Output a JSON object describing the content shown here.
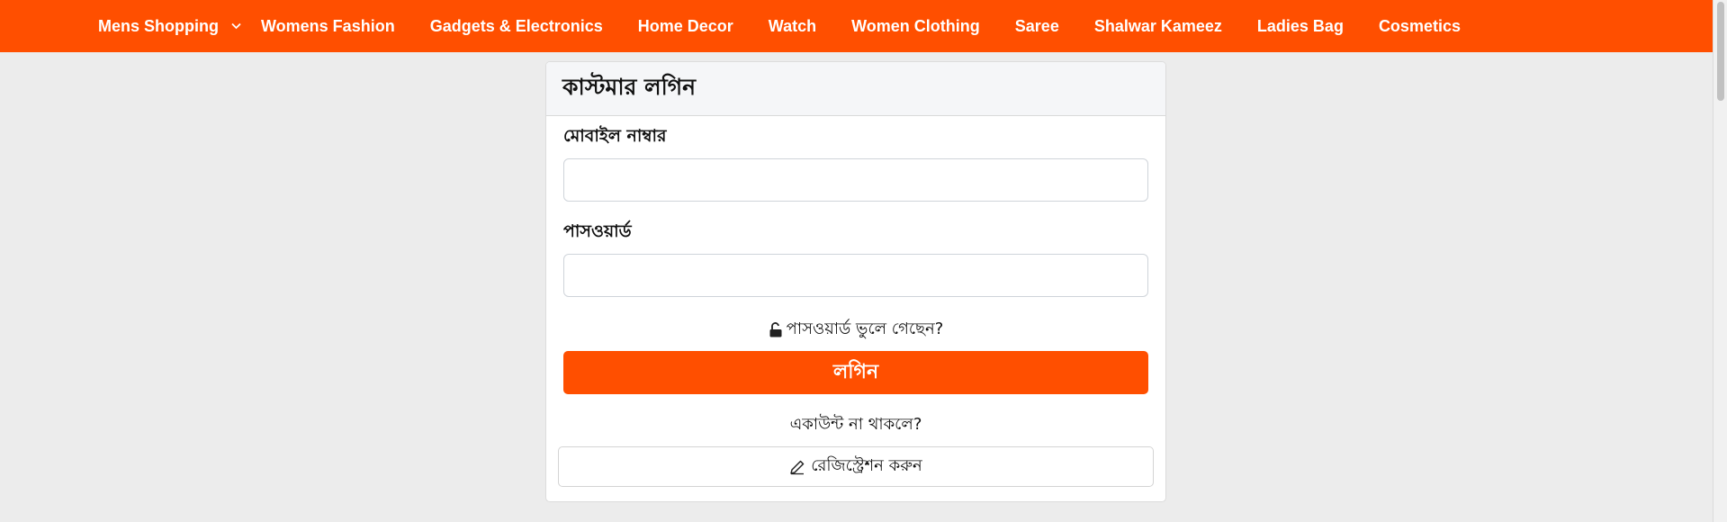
{
  "nav": {
    "items": [
      {
        "label": "Mens Shopping",
        "has_dropdown": true
      },
      {
        "label": "Womens Fashion"
      },
      {
        "label": "Gadgets & Electronics"
      },
      {
        "label": "Home Decor"
      },
      {
        "label": "Watch"
      },
      {
        "label": "Women Clothing"
      },
      {
        "label": "Saree"
      },
      {
        "label": "Shalwar Kameez"
      },
      {
        "label": "Ladies Bag"
      },
      {
        "label": "Cosmetics"
      }
    ]
  },
  "login": {
    "title": "কাস্টমার লগিন",
    "mobile_label": "মোবাইল নাম্বার",
    "mobile_value": "",
    "password_label": "পাসওয়ার্ড",
    "password_value": "",
    "forgot_label": "পাসওয়ার্ড ভুলে গেছেন?",
    "login_button": "লগিন",
    "no_account_text": "একাউন্ট না থাকলে?",
    "register_button": "রেজিস্ট্রেশন করুন"
  },
  "icons": {
    "dropdown": "chevron-down-icon",
    "forgot": "unlock-icon",
    "register": "pencil-icon"
  },
  "colors": {
    "brand": "#ff4f00",
    "background": "#ececec"
  }
}
